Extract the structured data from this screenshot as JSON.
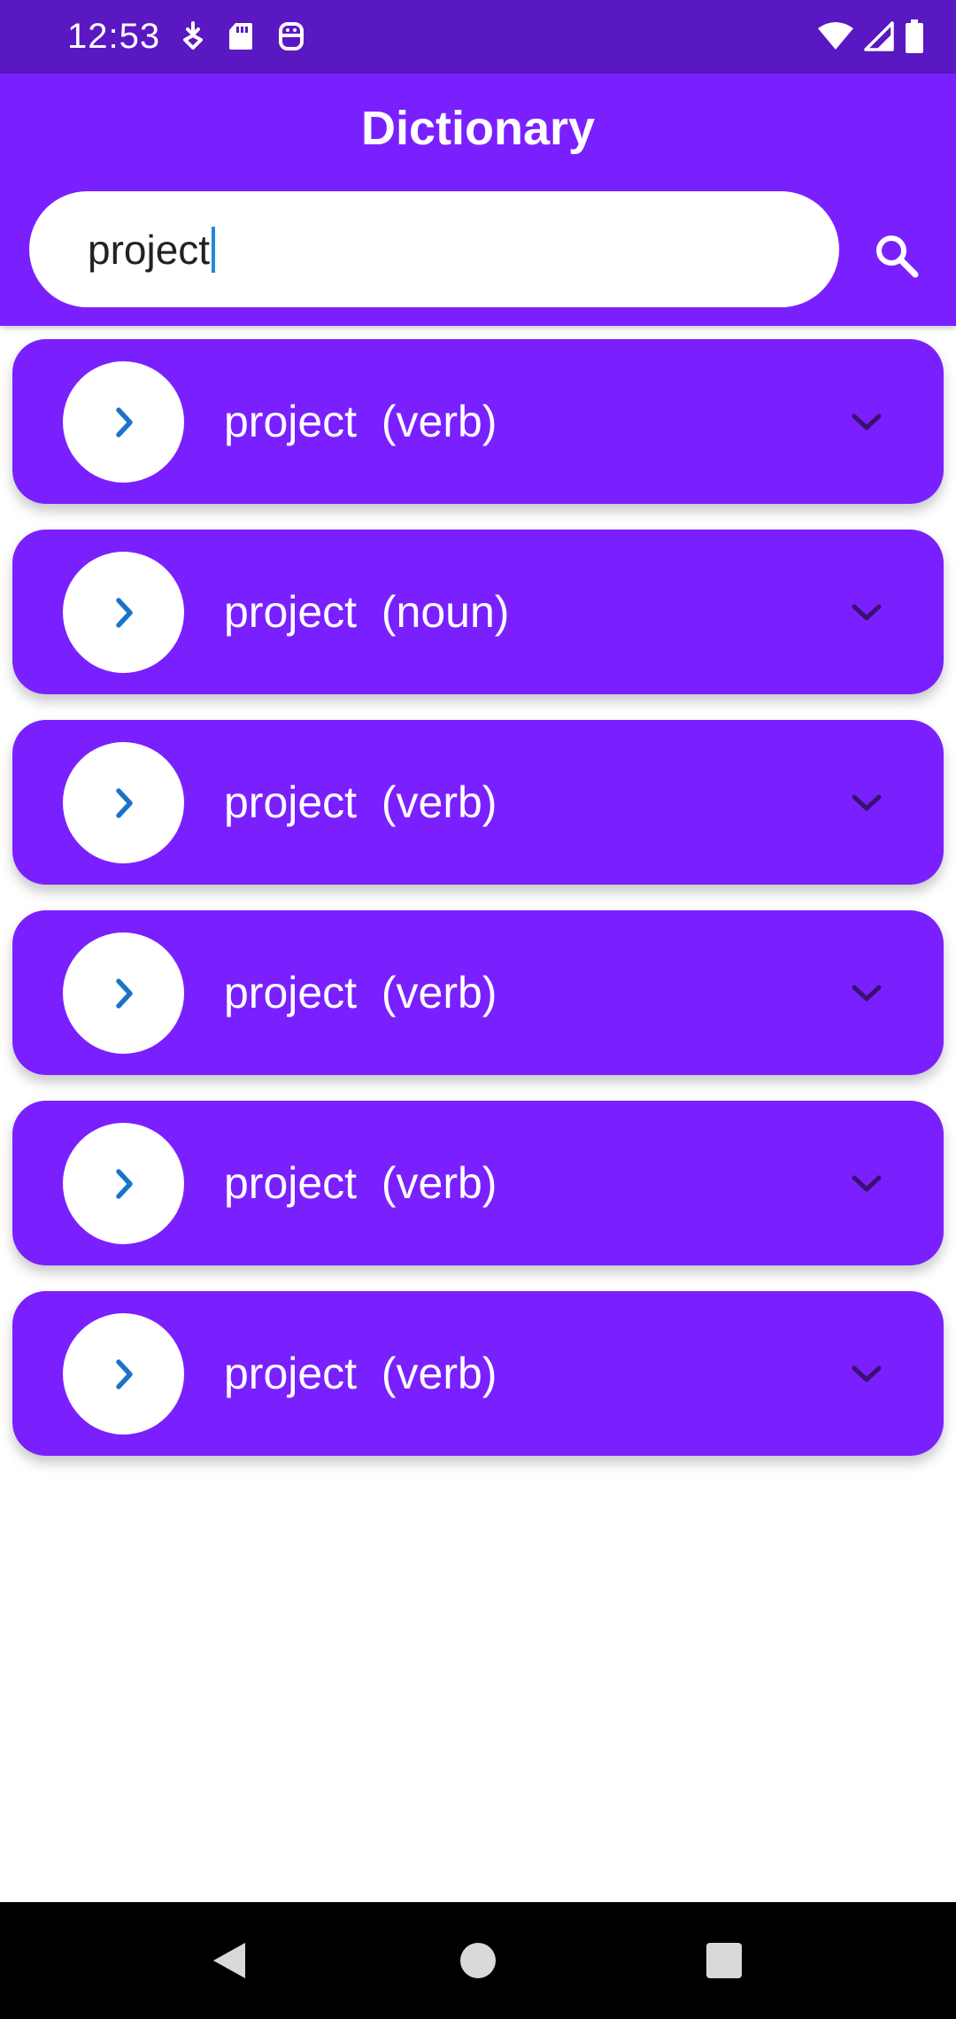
{
  "status_bar": {
    "time": "12:53",
    "left_icons": [
      "download-notification-icon",
      "sd-card-icon",
      "assistant-notification-icon"
    ],
    "right_icons": [
      "wifi-icon",
      "cell-signal-icon",
      "battery-icon"
    ]
  },
  "app_bar": {
    "title": "Dictionary"
  },
  "search": {
    "value": "project",
    "icon": "search-icon"
  },
  "results": [
    {
      "word": "project",
      "pos": "(verb)"
    },
    {
      "word": "project",
      "pos": "(noun)"
    },
    {
      "word": "project",
      "pos": "(verb)"
    },
    {
      "word": "project",
      "pos": "(verb)"
    },
    {
      "word": "project",
      "pos": "(verb)"
    },
    {
      "word": "project",
      "pos": "(verb)"
    }
  ],
  "colors": {
    "status_bar": "#5a18c2",
    "primary": "#7a20ff",
    "chevron_accent": "#1a73c8",
    "expand_icon": "#3a1070"
  },
  "nav_bar": {
    "buttons": [
      "back-icon",
      "home-icon",
      "recents-icon"
    ]
  }
}
